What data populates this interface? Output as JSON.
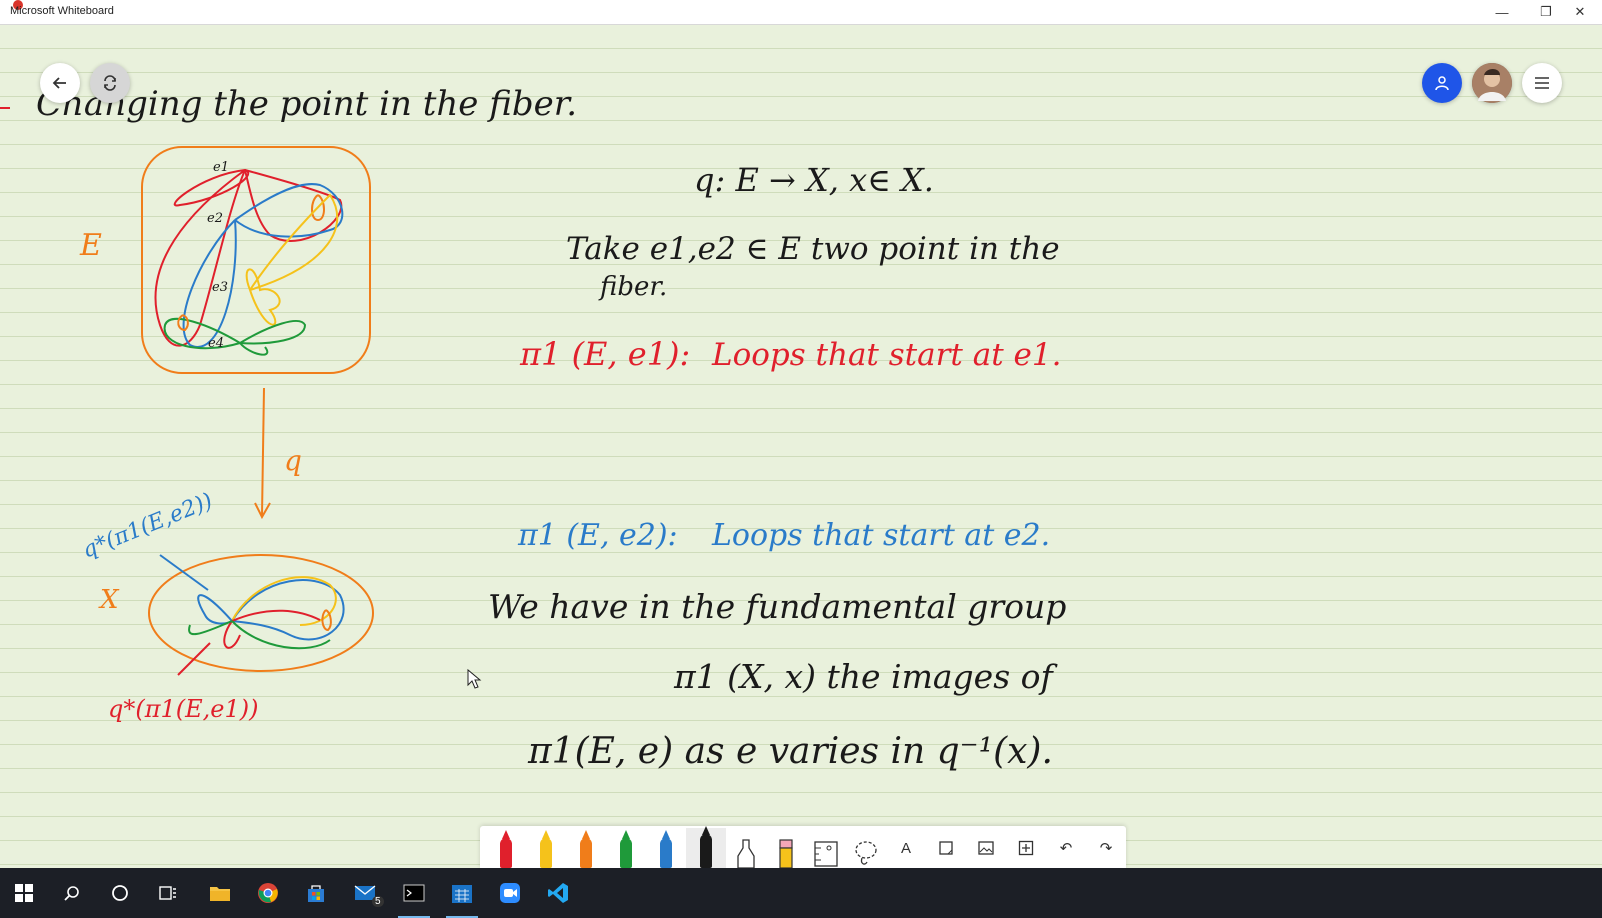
{
  "window": {
    "title": "Microsoft Whiteboard",
    "controls": {
      "minimize": "—",
      "restore": "❐",
      "close": "✕"
    }
  },
  "canvas": {
    "colors": {
      "ink_black": "#1a1a1a",
      "ink_red": "#e0202c",
      "ink_blue": "#2a7bc9",
      "ink_orange": "#f07d1a",
      "ink_yellow": "#f5c21b",
      "ink_green": "#1f9a3a"
    },
    "heading": "Changing the point in the fiber.",
    "diagram": {
      "space_E": "E",
      "space_X": "X",
      "points": [
        "e1",
        "e2",
        "e3",
        "e4"
      ],
      "map_label": "q",
      "image_label_e2": "q*(π1(E,e2))",
      "image_label_e1": "q*(π1(E,e1))"
    },
    "notes": {
      "line1": "q: E → X,  x∈ X.",
      "line2a": "Take   e1,e2 ∈ E   two   point   in   the",
      "line2b": "fiber.",
      "pi1_e1_lhs": "π1 (E, e1):",
      "pi1_e1_rhs": "Loops  that  start  at  e1.",
      "pi1_e2_lhs": "π1 (E, e2):",
      "pi1_e2_rhs": "Loops   that  start  at  e2.",
      "line5": "We   have   in   the   fundamental   group",
      "line6": "π1 (X, x)     the     images     of",
      "line7": "π1(E, e)   as   e varies   in   q⁻¹(x)."
    }
  },
  "top_controls": {
    "back_icon": "arrow-left-icon",
    "sync_icon": "sync-icon",
    "invite_icon": "invite-person-icon",
    "menu_icon": "hamburger-icon"
  },
  "toolbar": {
    "pens": [
      {
        "name": "pen-red",
        "color": "#e0202c"
      },
      {
        "name": "pen-yellow",
        "color": "#f5c21b"
      },
      {
        "name": "pen-orange",
        "color": "#f07d1a"
      },
      {
        "name": "pen-green",
        "color": "#1f9a3a"
      },
      {
        "name": "pen-blue",
        "color": "#2a7bc9"
      },
      {
        "name": "pen-black",
        "color": "#1a1a1a"
      }
    ],
    "text_tool": "A",
    "undo": "↶",
    "redo": "↷"
  },
  "taskbar": {
    "mail_badge": "5"
  }
}
